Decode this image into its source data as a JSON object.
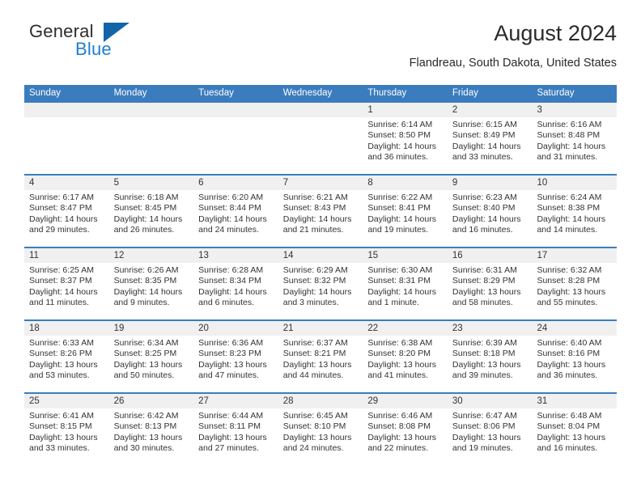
{
  "brand": {
    "name_part1": "General",
    "name_part2": "Blue",
    "triangle_color": "#1363a8",
    "blue_color": "#1c7fd4"
  },
  "header": {
    "title": "August 2024",
    "location": "Flandreau, South Dakota, United States"
  },
  "theme": {
    "header_band": "#3b7cbf",
    "daynum_band": "#f0f0f0",
    "text": "#333333"
  },
  "calendar": {
    "weekdays": [
      "Sunday",
      "Monday",
      "Tuesday",
      "Wednesday",
      "Thursday",
      "Friday",
      "Saturday"
    ],
    "weeks": [
      [
        {
          "day": "",
          "empty": true
        },
        {
          "day": "",
          "empty": true
        },
        {
          "day": "",
          "empty": true
        },
        {
          "day": "",
          "empty": true
        },
        {
          "day": "1",
          "sunrise": "Sunrise: 6:14 AM",
          "sunset": "Sunset: 8:50 PM",
          "daylight1": "Daylight: 14 hours",
          "daylight2": "and 36 minutes."
        },
        {
          "day": "2",
          "sunrise": "Sunrise: 6:15 AM",
          "sunset": "Sunset: 8:49 PM",
          "daylight1": "Daylight: 14 hours",
          "daylight2": "and 33 minutes."
        },
        {
          "day": "3",
          "sunrise": "Sunrise: 6:16 AM",
          "sunset": "Sunset: 8:48 PM",
          "daylight1": "Daylight: 14 hours",
          "daylight2": "and 31 minutes."
        }
      ],
      [
        {
          "day": "4",
          "sunrise": "Sunrise: 6:17 AM",
          "sunset": "Sunset: 8:47 PM",
          "daylight1": "Daylight: 14 hours",
          "daylight2": "and 29 minutes."
        },
        {
          "day": "5",
          "sunrise": "Sunrise: 6:18 AM",
          "sunset": "Sunset: 8:45 PM",
          "daylight1": "Daylight: 14 hours",
          "daylight2": "and 26 minutes."
        },
        {
          "day": "6",
          "sunrise": "Sunrise: 6:20 AM",
          "sunset": "Sunset: 8:44 PM",
          "daylight1": "Daylight: 14 hours",
          "daylight2": "and 24 minutes."
        },
        {
          "day": "7",
          "sunrise": "Sunrise: 6:21 AM",
          "sunset": "Sunset: 8:43 PM",
          "daylight1": "Daylight: 14 hours",
          "daylight2": "and 21 minutes."
        },
        {
          "day": "8",
          "sunrise": "Sunrise: 6:22 AM",
          "sunset": "Sunset: 8:41 PM",
          "daylight1": "Daylight: 14 hours",
          "daylight2": "and 19 minutes."
        },
        {
          "day": "9",
          "sunrise": "Sunrise: 6:23 AM",
          "sunset": "Sunset: 8:40 PM",
          "daylight1": "Daylight: 14 hours",
          "daylight2": "and 16 minutes."
        },
        {
          "day": "10",
          "sunrise": "Sunrise: 6:24 AM",
          "sunset": "Sunset: 8:38 PM",
          "daylight1": "Daylight: 14 hours",
          "daylight2": "and 14 minutes."
        }
      ],
      [
        {
          "day": "11",
          "sunrise": "Sunrise: 6:25 AM",
          "sunset": "Sunset: 8:37 PM",
          "daylight1": "Daylight: 14 hours",
          "daylight2": "and 11 minutes."
        },
        {
          "day": "12",
          "sunrise": "Sunrise: 6:26 AM",
          "sunset": "Sunset: 8:35 PM",
          "daylight1": "Daylight: 14 hours",
          "daylight2": "and 9 minutes."
        },
        {
          "day": "13",
          "sunrise": "Sunrise: 6:28 AM",
          "sunset": "Sunset: 8:34 PM",
          "daylight1": "Daylight: 14 hours",
          "daylight2": "and 6 minutes."
        },
        {
          "day": "14",
          "sunrise": "Sunrise: 6:29 AM",
          "sunset": "Sunset: 8:32 PM",
          "daylight1": "Daylight: 14 hours",
          "daylight2": "and 3 minutes."
        },
        {
          "day": "15",
          "sunrise": "Sunrise: 6:30 AM",
          "sunset": "Sunset: 8:31 PM",
          "daylight1": "Daylight: 14 hours",
          "daylight2": "and 1 minute."
        },
        {
          "day": "16",
          "sunrise": "Sunrise: 6:31 AM",
          "sunset": "Sunset: 8:29 PM",
          "daylight1": "Daylight: 13 hours",
          "daylight2": "and 58 minutes."
        },
        {
          "day": "17",
          "sunrise": "Sunrise: 6:32 AM",
          "sunset": "Sunset: 8:28 PM",
          "daylight1": "Daylight: 13 hours",
          "daylight2": "and 55 minutes."
        }
      ],
      [
        {
          "day": "18",
          "sunrise": "Sunrise: 6:33 AM",
          "sunset": "Sunset: 8:26 PM",
          "daylight1": "Daylight: 13 hours",
          "daylight2": "and 53 minutes."
        },
        {
          "day": "19",
          "sunrise": "Sunrise: 6:34 AM",
          "sunset": "Sunset: 8:25 PM",
          "daylight1": "Daylight: 13 hours",
          "daylight2": "and 50 minutes."
        },
        {
          "day": "20",
          "sunrise": "Sunrise: 6:36 AM",
          "sunset": "Sunset: 8:23 PM",
          "daylight1": "Daylight: 13 hours",
          "daylight2": "and 47 minutes."
        },
        {
          "day": "21",
          "sunrise": "Sunrise: 6:37 AM",
          "sunset": "Sunset: 8:21 PM",
          "daylight1": "Daylight: 13 hours",
          "daylight2": "and 44 minutes."
        },
        {
          "day": "22",
          "sunrise": "Sunrise: 6:38 AM",
          "sunset": "Sunset: 8:20 PM",
          "daylight1": "Daylight: 13 hours",
          "daylight2": "and 41 minutes."
        },
        {
          "day": "23",
          "sunrise": "Sunrise: 6:39 AM",
          "sunset": "Sunset: 8:18 PM",
          "daylight1": "Daylight: 13 hours",
          "daylight2": "and 39 minutes."
        },
        {
          "day": "24",
          "sunrise": "Sunrise: 6:40 AM",
          "sunset": "Sunset: 8:16 PM",
          "daylight1": "Daylight: 13 hours",
          "daylight2": "and 36 minutes."
        }
      ],
      [
        {
          "day": "25",
          "sunrise": "Sunrise: 6:41 AM",
          "sunset": "Sunset: 8:15 PM",
          "daylight1": "Daylight: 13 hours",
          "daylight2": "and 33 minutes."
        },
        {
          "day": "26",
          "sunrise": "Sunrise: 6:42 AM",
          "sunset": "Sunset: 8:13 PM",
          "daylight1": "Daylight: 13 hours",
          "daylight2": "and 30 minutes."
        },
        {
          "day": "27",
          "sunrise": "Sunrise: 6:44 AM",
          "sunset": "Sunset: 8:11 PM",
          "daylight1": "Daylight: 13 hours",
          "daylight2": "and 27 minutes."
        },
        {
          "day": "28",
          "sunrise": "Sunrise: 6:45 AM",
          "sunset": "Sunset: 8:10 PM",
          "daylight1": "Daylight: 13 hours",
          "daylight2": "and 24 minutes."
        },
        {
          "day": "29",
          "sunrise": "Sunrise: 6:46 AM",
          "sunset": "Sunset: 8:08 PM",
          "daylight1": "Daylight: 13 hours",
          "daylight2": "and 22 minutes."
        },
        {
          "day": "30",
          "sunrise": "Sunrise: 6:47 AM",
          "sunset": "Sunset: 8:06 PM",
          "daylight1": "Daylight: 13 hours",
          "daylight2": "and 19 minutes."
        },
        {
          "day": "31",
          "sunrise": "Sunrise: 6:48 AM",
          "sunset": "Sunset: 8:04 PM",
          "daylight1": "Daylight: 13 hours",
          "daylight2": "and 16 minutes."
        }
      ]
    ]
  }
}
